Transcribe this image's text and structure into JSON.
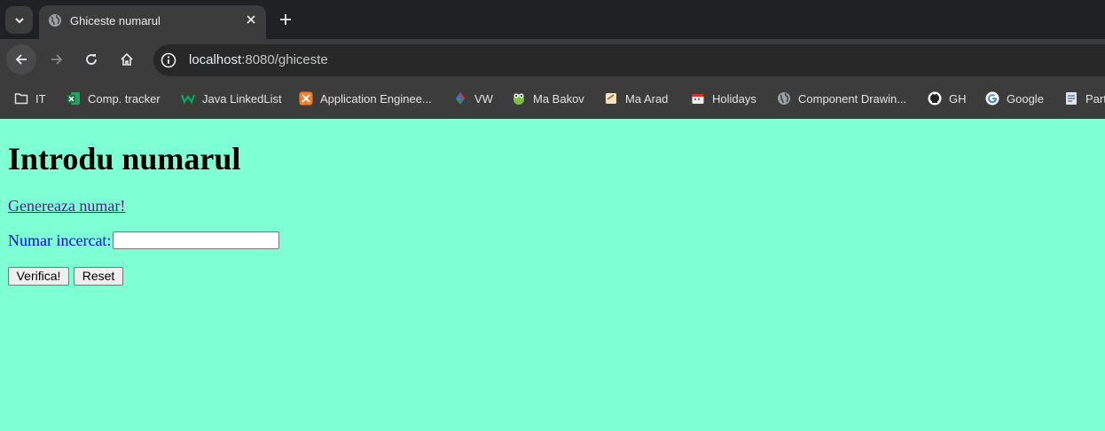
{
  "tab": {
    "title": "Ghiceste numarul"
  },
  "address": {
    "host": "localhost",
    "path": ":8080/ghiceste"
  },
  "bookmarks": [
    {
      "label": "IT",
      "icon": "folder-icon"
    },
    {
      "label": "Comp. tracker",
      "icon": "excel-icon"
    },
    {
      "label": "Java LinkedList",
      "icon": "w-logo-icon"
    },
    {
      "label": "Application Enginee...",
      "icon": "xampp-icon"
    },
    {
      "label": "VW",
      "icon": "vw-icon"
    },
    {
      "label": "Ma Bakov",
      "icon": "frog-icon"
    },
    {
      "label": "Ma Arad",
      "icon": "note-icon"
    },
    {
      "label": "Holidays",
      "icon": "calendar-icon"
    },
    {
      "label": "Component Drawin...",
      "icon": "globe-icon"
    },
    {
      "label": "GH",
      "icon": "github-icon"
    },
    {
      "label": "Google",
      "icon": "google-icon"
    },
    {
      "label": "Part",
      "icon": "doc-icon"
    }
  ],
  "page": {
    "heading": "Introdu numarul",
    "generate_link": "Genereaza numar!",
    "input_label": "Numar incercat:",
    "input_value": "",
    "verify_button": "Verifica!",
    "reset_button": "Reset",
    "background": "#7fffd4"
  }
}
